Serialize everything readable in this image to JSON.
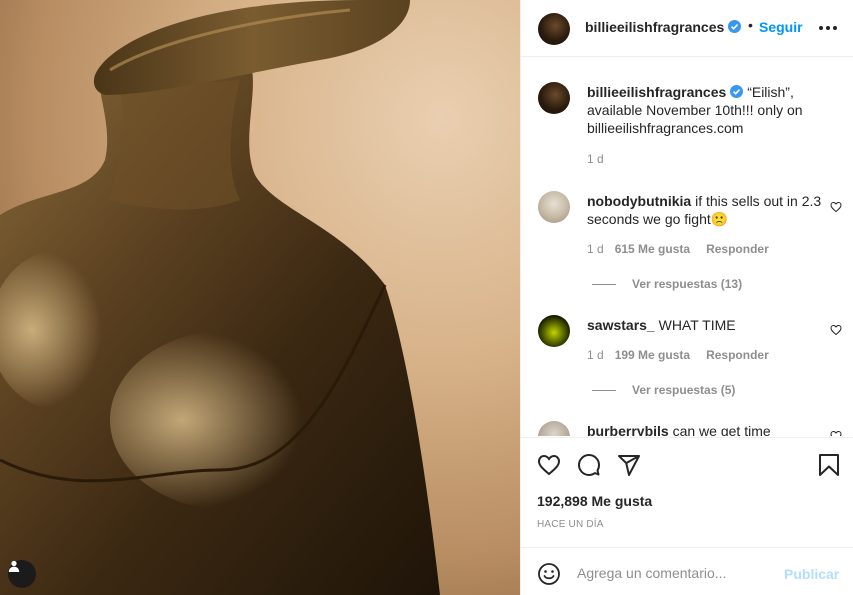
{
  "post": {
    "image_alt": "Golden bust-shaped perfume bottle",
    "author": "billieeilishfragrances",
    "follow_label": "Seguir",
    "dot_separator": "•",
    "caption": "“Eilish”, available November 10th!!! only on billieeilishfragrances.com",
    "caption_age": "1 d"
  },
  "comments": [
    {
      "username": "nobodybutnikia",
      "text": "if this sells out in 2.3 seconds we go fight🙁",
      "age": "1 d",
      "likes": "615 Me gusta",
      "reply_label": "Responder",
      "view_replies": "Ver respuestas (13)"
    },
    {
      "username": "sawstars_",
      "text": "WHAT TIME",
      "age": "1 d",
      "likes": "199 Me gusta",
      "reply_label": "Responder",
      "view_replies": "Ver respuestas (5)"
    },
    {
      "username": "burberrybils",
      "text": "can we get time"
    }
  ],
  "actions": {
    "like_count": "192,898 Me gusta",
    "time_ago": "HACE UN DÍA",
    "comment_placeholder": "Agrega un comentario...",
    "publish_label": "Publicar"
  },
  "colors": {
    "link_blue": "#0095f6",
    "publish_disabled": "#b2dffc",
    "muted_text": "#8e8e8e",
    "verified_badge": "#3897f0"
  }
}
